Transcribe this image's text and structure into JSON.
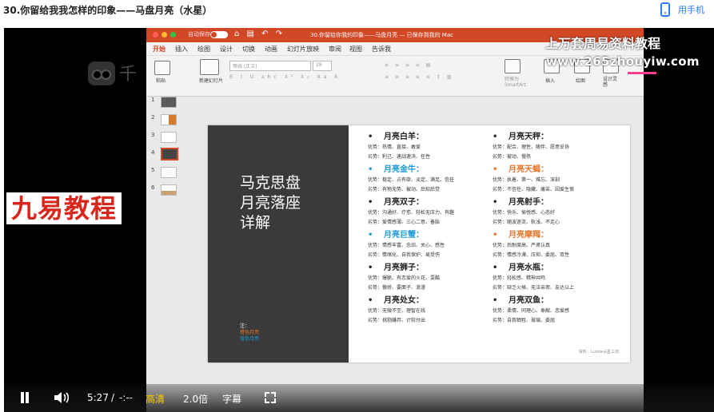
{
  "page": {
    "title": "30.你留给我我怎样的印象——马盘月亮（水星）",
    "phone_link": "用手机"
  },
  "player": {
    "brand_text": "千",
    "overlay_left": "九易教程",
    "watermark_line1": "上万套周易资料教程",
    "watermark_line2": "www.265zhouyiw.com",
    "controls": {
      "time_current": "5:27",
      "time_sep": "/",
      "time_total": "-:--",
      "quality": "高清",
      "speed": "2.0倍",
      "subtitles": "字幕"
    }
  },
  "app": {
    "autosave": "自动保存",
    "doc_title": "30.你留给你我的印象——马盘月亮 — 已保存到我的 Mac",
    "tabs": [
      "开始",
      "插入",
      "绘图",
      "设计",
      "切换",
      "动画",
      "幻灯片放映",
      "审阅",
      "视图",
      "告诉我"
    ],
    "ribbon": {
      "paste": "粘贴",
      "new_slide": "新建幻灯片",
      "font_placeholder": "等线 (正文)",
      "font_size": "28",
      "smartart": "转换为SmartArt",
      "insert": "插入",
      "shapes": "绘图",
      "designer": "设计灵感"
    },
    "thumbs": [
      "1",
      "2",
      "3",
      "4",
      "5",
      "6"
    ]
  },
  "slide": {
    "title": [
      "马克思盘",
      "月亮落座",
      "详解"
    ],
    "note_label": "注：",
    "note_line1": "橙色月亮",
    "note_line2": "蓝色月亮",
    "credit": "资料：Lumix占星工坊",
    "colors": {
      "dark": "#222222",
      "blue": "#1a9ad6",
      "orange": "#e5772c"
    },
    "left_column": [
      {
        "heading": "月亮白羊：",
        "color": "dark",
        "lines": [
          "优势：热情、直接、敢爱",
          "劣势：利己、速战速决、任性"
        ]
      },
      {
        "heading": "月亮金牛：",
        "color": "blue",
        "lines": [
          "优势：稳定、占有欲、淡定、满足、信任",
          "劣势：有物无势、被动、后知后觉"
        ]
      },
      {
        "heading": "月亮双子：",
        "color": "dark",
        "lines": [
          "优势：沟通好、疗愈、轻松无压力、有趣",
          "劣势：爱情感薄、三心二意、备胎"
        ]
      },
      {
        "heading": "月亮巨蟹：",
        "color": "blue",
        "lines": [
          "优势：情感丰富、念旧、关心、感性",
          "劣势：情绪化、自我保护、易受伤"
        ]
      },
      {
        "heading": "月亮狮子：",
        "color": "dark",
        "lines": [
          "优势：爆脆、有恋爱的火花、耍酷",
          "劣势：傲娇、要面子、浪漫"
        ]
      },
      {
        "heading": "月亮处女：",
        "color": "dark",
        "lines": [
          "优势：无微不至、理智在线",
          "劣势：挑剔嫌弃、计较付出"
        ]
      }
    ],
    "right_column": [
      {
        "heading": "月亮天秤：",
        "color": "dark",
        "lines": [
          "优势：配合、理性、随伴、愿意妥协",
          "劣势：被动、慢热"
        ]
      },
      {
        "heading": "月亮天蝎：",
        "color": "orange",
        "lines": [
          "优势：执着、第一、难忘、深刻",
          "劣势：不信任、隐藏、痛苦、因爱生恨"
        ]
      },
      {
        "heading": "月亮射手：",
        "color": "dark",
        "lines": [
          "优势：快乐、愉悦感、心态好",
          "劣势：随波逐流、轨浅、不走心"
        ]
      },
      {
        "heading": "月亮摩羯：",
        "color": "orange",
        "lines": [
          "优势：后耐度高、严肃认真",
          "劣势：情感冷漠、压抑、委屈、双性"
        ]
      },
      {
        "heading": "月亮水瓶：",
        "color": "dark",
        "lines": [
          "优势：轻松感、精神共鸣",
          "劣势：缺乏火候、无法亲密、友达以上"
        ]
      },
      {
        "heading": "月亮双鱼：",
        "color": "dark",
        "lines": [
          "优势：柔情、同理心、奉献、恋爱感",
          "劣势：自我牺牲、玻璃、委屈"
        ]
      }
    ]
  }
}
